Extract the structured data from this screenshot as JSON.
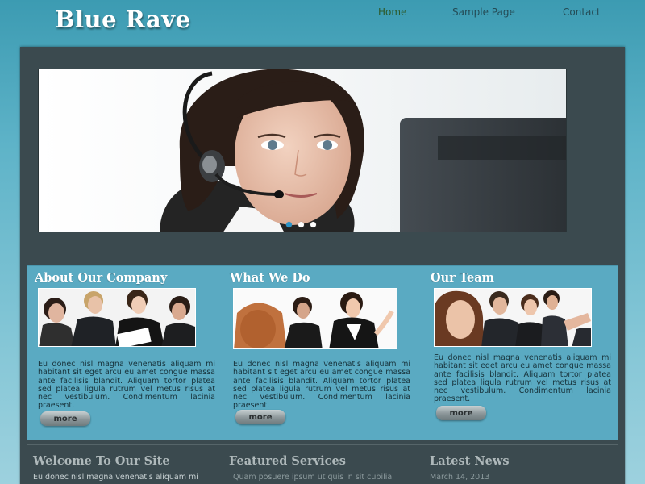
{
  "site": {
    "title": "Blue Rave"
  },
  "nav": {
    "items": [
      {
        "label": "Home"
      },
      {
        "label": "Sample Page"
      },
      {
        "label": "Contact"
      }
    ]
  },
  "slider": {
    "dot_count": 3,
    "active_index": 0
  },
  "features": [
    {
      "heading": "About Our Company",
      "text": "Eu donec nisl magna venenatis aliquam mi habitant sit eget arcu eu amet congue massa ante facilisis blandit. Aliquam tortor platea sed platea ligula rutrum vel metus risus at nec vestibulum. Condimentum lacinia praesent.",
      "button": "more"
    },
    {
      "heading": "What We Do",
      "text": "Eu donec nisl magna venenatis aliquam mi habitant sit eget arcu eu amet congue massa ante facilisis blandit. Aliquam tortor platea sed platea ligula rutrum vel metus risus at nec vestibulum. Condimentum lacinia praesent.",
      "button": "more"
    },
    {
      "heading": "Our Team",
      "text": "Eu donec nisl magna venenatis aliquam mi habitant sit eget arcu eu amet congue massa ante facilisis blandit. Aliquam tortor platea sed platea ligula rutrum vel metus risus at nec vestibulum. Condimentum lacinia praesent.",
      "button": "more"
    }
  ],
  "bottom": [
    {
      "heading": "Welcome To Our Site",
      "text": "Eu donec nisl magna venenatis aliquam mi"
    },
    {
      "heading": "Featured Services",
      "text": "Quam posuere ipsum ut quis in sit cubilia"
    },
    {
      "heading": "Latest News",
      "text": "March 14, 2013"
    }
  ],
  "colors": {
    "accent": "#5aaac2",
    "panel": "#3b4a4f",
    "active_dot": "#2b94c8"
  }
}
